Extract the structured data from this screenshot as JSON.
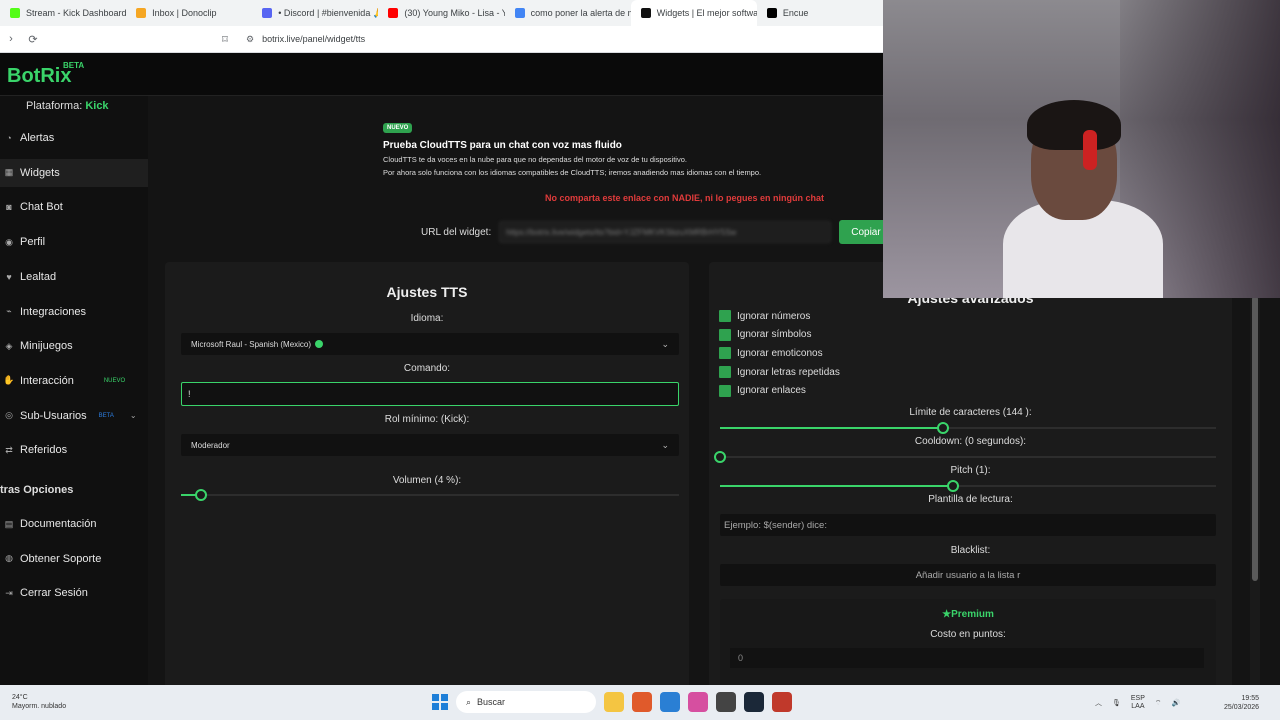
{
  "browser": {
    "tabs": [
      {
        "title": "Stream - Kick Dashboard",
        "color": "#53fc18"
      },
      {
        "title": "Inbox | Donoclip",
        "color": "#f5a623"
      },
      {
        "title": "• Discord | #bienvenida 🙏 | Sl",
        "color": "#5865f2"
      },
      {
        "title": "(30) Young Miko - Lisa - YouTu",
        "color": "#ff0000"
      },
      {
        "title": "como poner la alerta de mi fo",
        "color": "#4285f4"
      },
      {
        "title": "Widgets | El mejor softwa",
        "color": "#111111",
        "active": true
      },
      {
        "title": "Encue",
        "color": "#000000"
      }
    ],
    "url": "botrix.live/panel/widget/tts"
  },
  "app": {
    "logo": "BotRix",
    "logo_badge": "BETA",
    "platform_label": "Plataforma:",
    "platform_value": "Kick"
  },
  "sidebar": {
    "items": [
      {
        "label": "Alertas",
        "icon": "bell-icon"
      },
      {
        "label": "Widgets",
        "icon": "grid-icon",
        "active": true
      },
      {
        "label": "Chat Bot",
        "icon": "robot-icon"
      },
      {
        "label": "Perfil",
        "icon": "user-icon"
      },
      {
        "label": "Lealtad",
        "icon": "heart-icon"
      },
      {
        "label": "Integraciones",
        "icon": "plug-icon"
      },
      {
        "label": "Minijuegos",
        "icon": "gamepad-icon"
      },
      {
        "label": "Interacción",
        "icon": "hand-icon",
        "badge": "NUEVO"
      },
      {
        "label": "Sub-Usuarios",
        "icon": "users-icon",
        "badge": "BETA"
      },
      {
        "label": "Referidos",
        "icon": "share-icon"
      }
    ],
    "other_section": "tras Opciones",
    "other_items": [
      {
        "label": "Documentación",
        "icon": "book-icon"
      },
      {
        "label": "Obtener Soporte",
        "icon": "support-icon"
      },
      {
        "label": "Cerrar Sesión",
        "icon": "logout-icon"
      }
    ]
  },
  "notice": {
    "pill": "NUEVO",
    "title": "Prueba CloudTTS para un chat con voz mas fluido",
    "line1": "CloudTTS te da voces en la nube para que no dependas del motor de voz de tu dispositivo.",
    "line2": "Por ahora solo funciona con los idiomas compatibles de CloudTTS; iremos anadiendo mas idiomas con el tiempo."
  },
  "warning": "No comparta este enlace con NADIE, ni lo pegues en ningún chat",
  "widget_url": {
    "label": "URL del widget:",
    "value": "https://botrix.live/widgets/tts?bid=YJZFMKVKSbzuXMRBrHY5Sw",
    "copy": "Copiar"
  },
  "tts": {
    "title": "Ajustes TTS",
    "idioma_label": "Idioma:",
    "idioma_value": "Microsoft Raul - Spanish (Mexico)",
    "comando_label": "Comando:",
    "comando_value": "!",
    "rol_label": "Rol mínimo: (Kick):",
    "rol_value": "Moderador",
    "volumen_label": "Volumen (4 %):",
    "volumen": 0.04
  },
  "advanced": {
    "title": "Ajustes avanzados",
    "checks": [
      "Ignorar números",
      "Ignorar símbolos",
      "Ignorar emoticonos",
      "Ignorar letras repetidas",
      "Ignorar enlaces"
    ],
    "limite_label": "Límite de caracteres (144 ):",
    "limite": 0.45,
    "cooldown_label": "Cooldown: (0 segundos):",
    "cooldown": 0,
    "pitch_label": "Pitch (1):",
    "pitch": 0.47,
    "plantilla_label": "Plantilla de lectura:",
    "plantilla_placeholder": "Ejemplo: $(sender) dice:",
    "blacklist_label": "Blacklist:",
    "blacklist_placeholder": "Añadir usuario a la lista r",
    "premium_title": "Premium",
    "costo_label": "Costo en puntos:",
    "costo_value": "0"
  },
  "taskbar": {
    "temp": "24°C",
    "weather": "Mayorm. nublado",
    "search": "Buscar",
    "lang1": "ESP",
    "lang2": "LAA",
    "time": "19:55",
    "date": "25/03/2026"
  }
}
